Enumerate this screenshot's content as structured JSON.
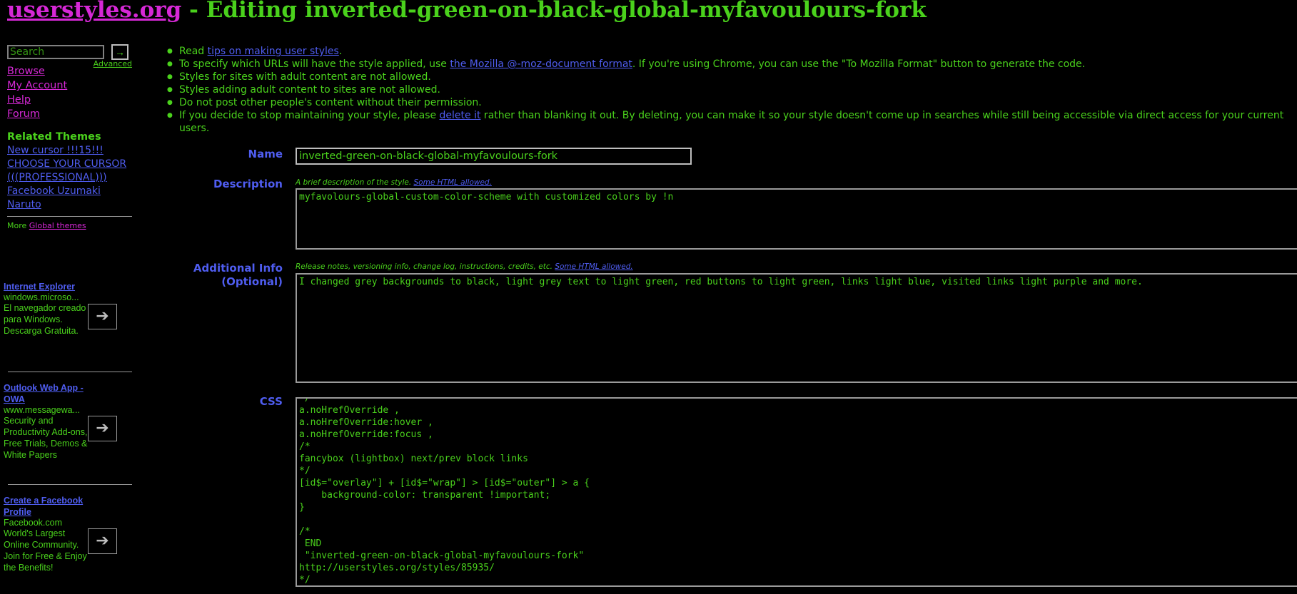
{
  "header": {
    "site": "userstyles.org",
    "separator": " - ",
    "title": "Editing inverted-green-on-black-global-myfavoulours-fork"
  },
  "sidebar": {
    "search_placeholder": "Search",
    "search_go": "→",
    "advanced": "Advanced",
    "nav": [
      "Browse",
      "My Account",
      "Help",
      "Forum"
    ],
    "related_heading": "Related Themes",
    "related": [
      "New cursor !!!15!!!",
      "CHOOSE YOUR CURSOR (((PROFESSIONAL)))",
      "Facebook Uzumaki Naruto"
    ],
    "more_prefix": "More ",
    "more_link": "Global themes"
  },
  "ads": [
    {
      "title": "Internet Explorer",
      "url": "windows.microso...",
      "desc": "El navegador creado para Windows. Descarga Gratuita."
    },
    {
      "title": "Outlook Web App - OWA",
      "url": "www.messagewa...",
      "desc": "Security and Productivity Add-ons, Free Trials, Demos & White Papers"
    },
    {
      "title": "Create a Facebook Profile",
      "url": "Facebook.com",
      "desc": "World's Largest Online Community. Join for Free & Enjoy the Benefits!"
    }
  ],
  "rules": {
    "r1_pre": "Read ",
    "r1_link": "tips on making user styles",
    "r1_post": ".",
    "r2_pre": "To specify which URLs will have the style applied, use ",
    "r2_link": "the Mozilla @-moz-document format",
    "r2_post": ". If you're using Chrome, you can use the \"To Mozilla Format\" button to generate the code.",
    "r3": "Styles for sites with adult content are not allowed.",
    "r4": "Styles adding adult content to sites are not allowed.",
    "r5": "Do not post other people's content without their permission.",
    "r6_pre": "If you decide to stop maintaining your style, please ",
    "r6_link": "delete it",
    "r6_post": " rather than blanking it out. By deleting, you can make it so your style doesn't come up in searches while still being accessible via direct access for your current users."
  },
  "form": {
    "name_label": "Name",
    "name_value": "inverted-green-on-black-global-myfavoulours-fork",
    "desc_label": "Description",
    "desc_hint": "A brief description of the style. ",
    "desc_hint_link": "Some HTML allowed.",
    "desc_value": "myfavolours-global-custom-color-scheme with customized colors by !n",
    "info_label_1": "Additional Info",
    "info_label_2": "(Optional)",
    "info_hint": "Release notes, versioning info, change log, instructions, credits, etc. ",
    "info_hint_link": "Some HTML allowed.",
    "info_value": "I changed grey backgrounds to black, light grey text to light green, red buttons to light green, links light blue, visited links light purple and more.",
    "css_label": "CSS",
    "css_value": "*/\na.noHrefOverride ,\na.noHrefOverride:hover ,\na.noHrefOverride:focus ,\n/*\nfancybox (lightbox) next/prev block links\n*/\n[id$=\"overlay\"] + [id$=\"wrap\"] > [id$=\"outer\"] > a {\n    background-color: transparent !important;\n}\n\n/*\n END\n \"inverted-green-on-black-global-myfavoulours-fork\"\nhttp://userstyles.org/styles/85935/\n*/"
  }
}
